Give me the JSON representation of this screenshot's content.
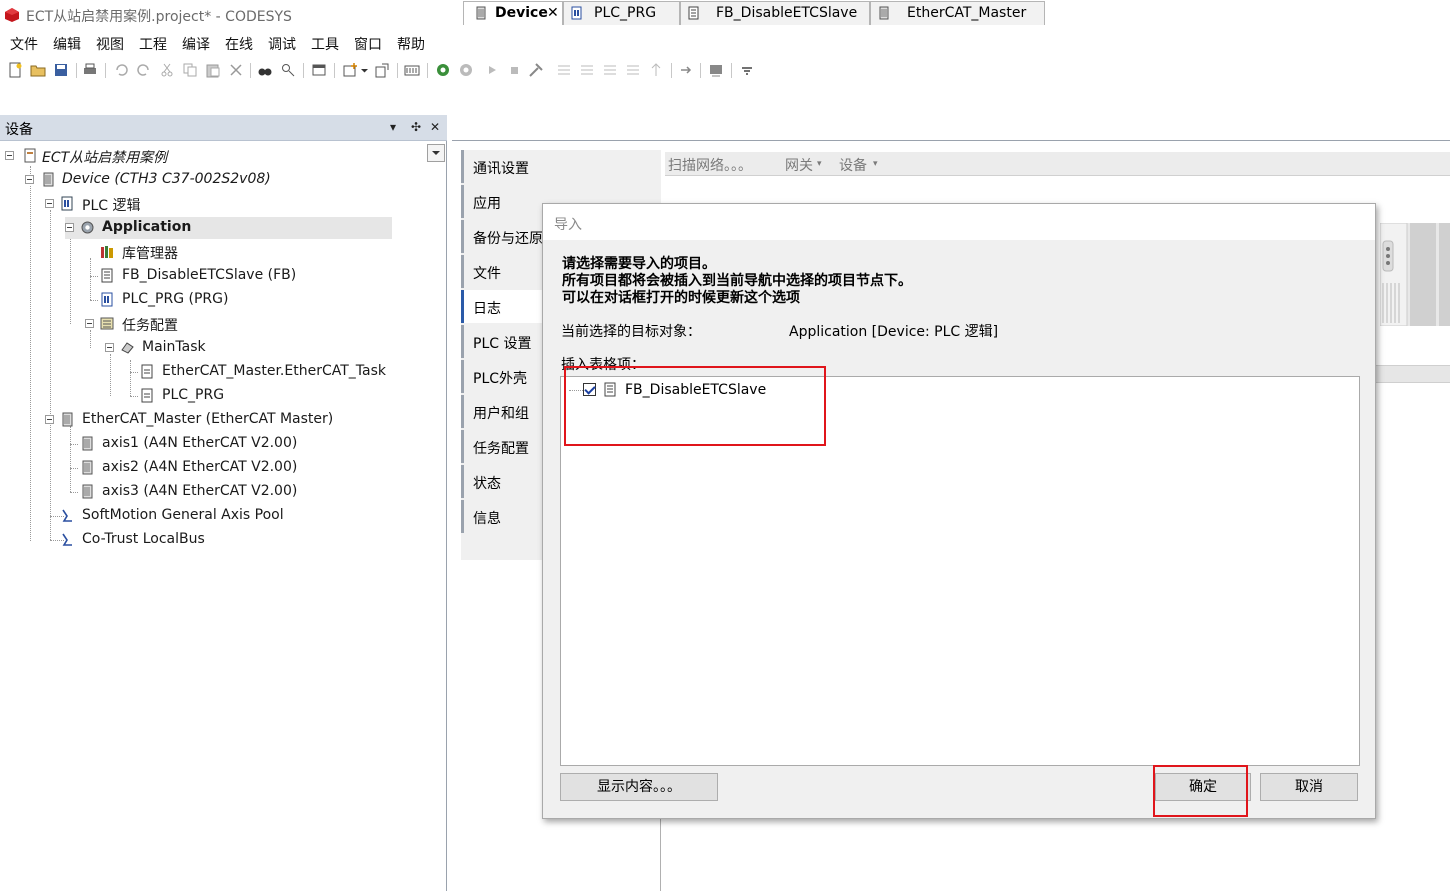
{
  "window": {
    "title": "ECT从站启禁用案例.project* - CODESYS"
  },
  "menu": [
    "文件",
    "编辑",
    "视图",
    "工程",
    "编译",
    "在线",
    "调试",
    "工具",
    "窗口",
    "帮助"
  ],
  "devices_panel": {
    "title": "设备",
    "tree": {
      "project": "ECT从站启禁用案例",
      "device": "Device (CTH3 C37-002S2v08)",
      "plc_logic": "PLC 逻辑",
      "application": "Application",
      "library_manager": "库管理器",
      "fb": "FB_DisableETCSlave (FB)",
      "plc_prg": "PLC_PRG (PRG)",
      "task_config": "任务配置",
      "main_task": "MainTask",
      "ethercat_task": "EtherCAT_Master.EtherCAT_Task",
      "task_plc_prg": "PLC_PRG",
      "ethercat_master": "EtherCAT_Master (EtherCAT Master)",
      "axis1": "axis1 (A4N EtherCAT V2.00)",
      "axis2": "axis2 (A4N EtherCAT V2.00)",
      "axis3": "axis3 (A4N EtherCAT V2.00)",
      "softmotion": "SoftMotion General Axis Pool",
      "localbus": "Co-Trust LocalBus"
    }
  },
  "tabs": [
    "Device",
    "PLC_PRG",
    "FB_DisableETCSlave",
    "EtherCAT_Master"
  ],
  "device_editor": {
    "side_tabs": [
      "通讯设置",
      "应用",
      "备份与还原",
      "文件",
      "日志",
      "PLC 设置",
      "PLC外壳",
      "用户和组",
      "任务配置",
      "状态",
      "信息"
    ],
    "scan_network": "扫描网络。。。",
    "gateway": "网关",
    "device": "设备"
  },
  "dialog": {
    "title": "导入",
    "line1": "请选择需要导入的项目。",
    "line2": "所有项目都将会被插入到当前导航中选择的项目节点下。",
    "line3": "可以在对话框打开的时候更新这个选项",
    "target_label": "当前选择的目标对象：",
    "target_value": "Application [Device: PLC 逻辑]",
    "insert_label": "插入表格项：",
    "item_label": "FB_DisableETCSlave",
    "item_checked": true,
    "show_content_button": "显示内容。。。",
    "ok_button": "确定",
    "cancel_button": "取消"
  },
  "colors": {
    "highlight": "#e0151b",
    "panel_header": "#d6dde7"
  }
}
